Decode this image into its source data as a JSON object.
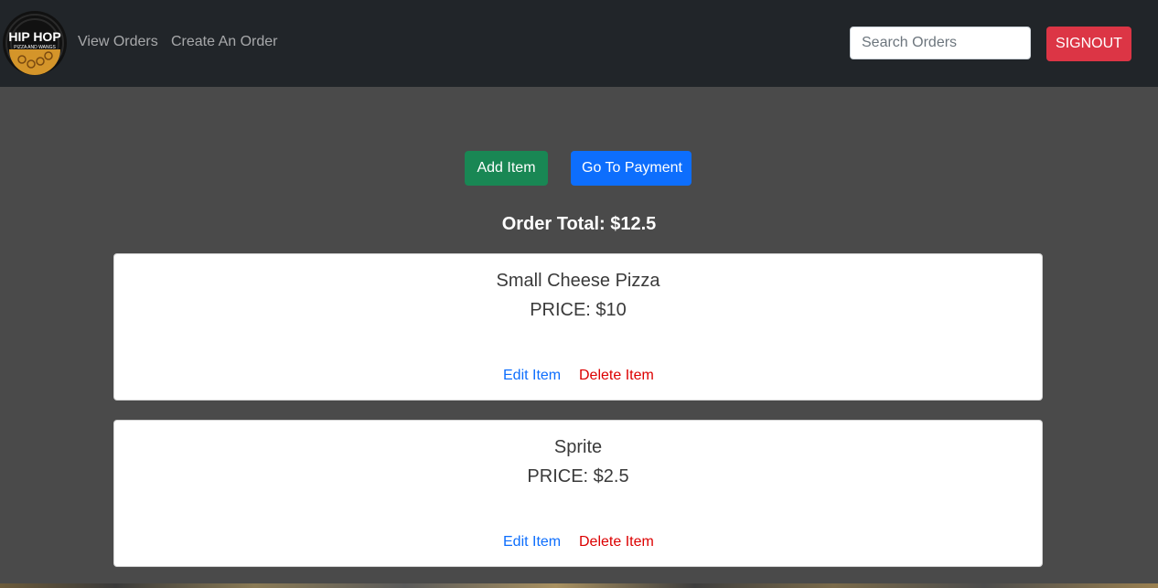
{
  "nav": {
    "logo_line1": "HIP HOP",
    "logo_line2": "PIZZA AND WANGS",
    "links": [
      "View Orders",
      "Create An Order"
    ],
    "search_placeholder": "Search Orders",
    "signout_label": "SIGNOUT"
  },
  "actions": {
    "add_item_label": "Add Item",
    "payment_label": "Go To Payment"
  },
  "order_total": "Order Total: $12.5",
  "items": [
    {
      "name": "Small Cheese Pizza",
      "price": "PRICE: $10",
      "edit_label": "Edit Item",
      "delete_label": "Delete Item"
    },
    {
      "name": "Sprite",
      "price": "PRICE: $2.5",
      "edit_label": "Edit Item",
      "delete_label": "Delete Item"
    }
  ],
  "colors": {
    "navbar": "#212529",
    "page_bg": "#4a4a4a",
    "add_button": "#198754",
    "payment_button": "#0d6efd",
    "signout_button": "#dc3545",
    "edit_link": "#0d6efd",
    "delete_link": "#dc0000"
  }
}
